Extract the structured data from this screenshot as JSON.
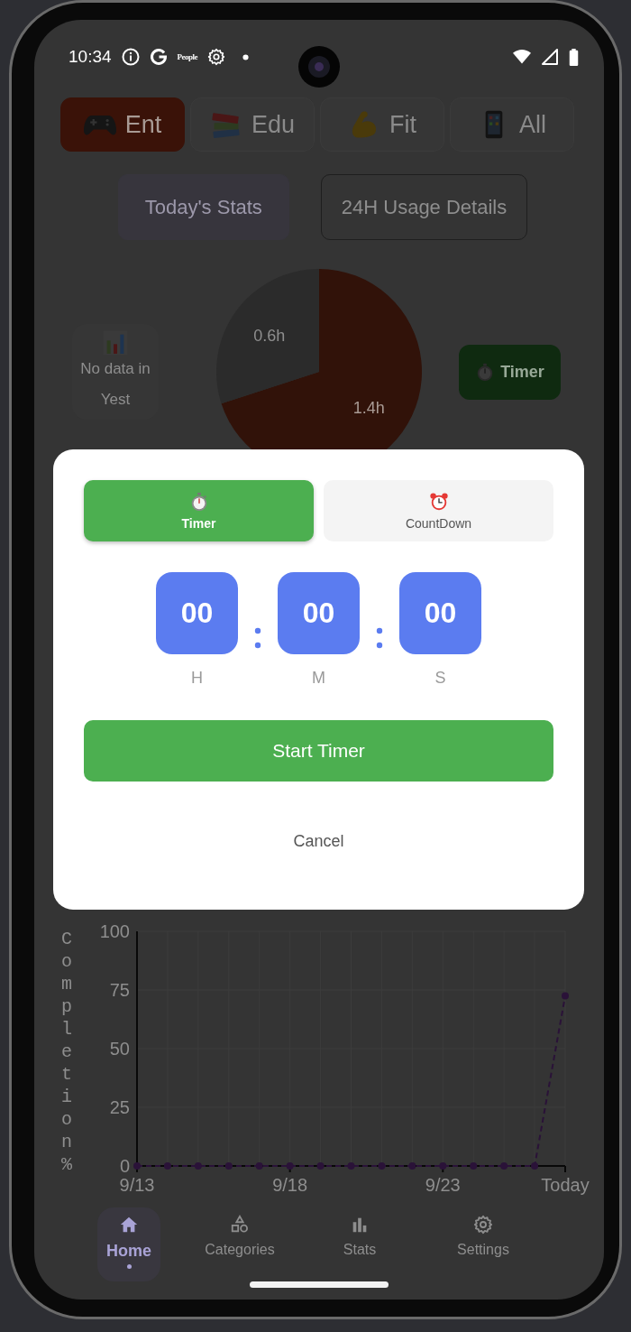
{
  "status_bar": {
    "time": "10:34",
    "notification_text": "People"
  },
  "category_tabs": [
    {
      "label": "Ent",
      "kind": "gamepad",
      "selected": true
    },
    {
      "label": "Edu",
      "kind": "books",
      "selected": false
    },
    {
      "label": "Fit",
      "kind": "arm",
      "selected": false
    },
    {
      "label": "All",
      "kind": "phone",
      "selected": false
    }
  ],
  "view_buttons": [
    {
      "label": "Today's Stats",
      "selected": true
    },
    {
      "label": "24H Usage Details",
      "selected": false
    }
  ],
  "yesterday_card": {
    "text": "No data in Yest"
  },
  "pie": {
    "chart_data": {
      "type": "pie",
      "values": [
        1.4,
        0.6
      ],
      "value_labels": [
        "1.4h",
        "0.6h"
      ]
    }
  },
  "timer_button": {
    "label": "Timer"
  },
  "chart": {
    "chart_data": {
      "type": "line",
      "ylabel": "Completion %",
      "categories": [
        "9/13",
        null,
        null,
        null,
        null,
        "9/18",
        null,
        null,
        null,
        null,
        "9/23",
        null,
        null,
        null,
        "Today"
      ],
      "ylim": [
        0,
        100
      ],
      "yticks": [
        0,
        25,
        50,
        75,
        100
      ],
      "grid": true,
      "series": [
        {
          "color": "#2a1238",
          "line_style": "dashed",
          "marker": "circle",
          "values": [
            0,
            0,
            0,
            0,
            0,
            0,
            0,
            0,
            0,
            0,
            0,
            0,
            0,
            0,
            72.5
          ]
        }
      ]
    }
  },
  "dialog": {
    "modes": [
      {
        "label": "Timer",
        "kind": "stopwatch",
        "selected": true
      },
      {
        "label": "CountDown",
        "kind": "alarm",
        "selected": false
      }
    ],
    "fields": [
      {
        "value": "00",
        "unit": "H"
      },
      {
        "value": "00",
        "unit": "M"
      },
      {
        "value": "00",
        "unit": "S"
      }
    ],
    "start_button": "Start Timer",
    "cancel_button": "Cancel"
  },
  "bottom_nav": [
    {
      "label": "Home",
      "kind": "home",
      "selected": true
    },
    {
      "label": "Categories",
      "kind": "shapes",
      "selected": false
    },
    {
      "label": "Stats",
      "kind": "bars",
      "selected": false
    },
    {
      "label": "Settings",
      "kind": "gear",
      "selected": false
    }
  ]
}
